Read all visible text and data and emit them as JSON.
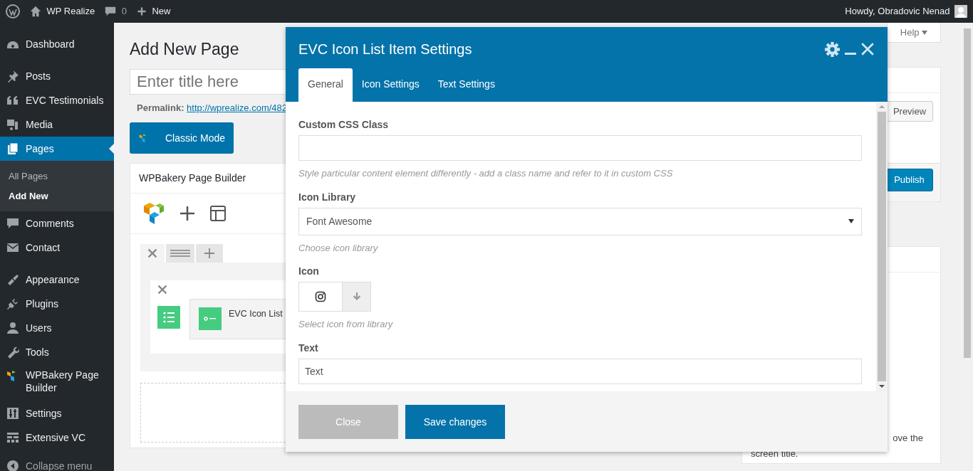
{
  "admin_bar": {
    "site": "WP Realize",
    "comments": "0",
    "new": "New",
    "greeting": "Howdy, Obradovic Nenad"
  },
  "menu_groups": [
    [
      {
        "label": "Dashboard",
        "selected": false
      }
    ],
    [
      {
        "label": "Posts",
        "selected": false
      },
      {
        "label": "EVC Testimonials",
        "selected": false
      },
      {
        "label": "Media",
        "selected": false
      },
      {
        "label": "Pages",
        "selected": true,
        "children": [
          {
            "label": "All Pages",
            "selected": false
          },
          {
            "label": "Add New",
            "selected": true
          }
        ]
      },
      {
        "label": "Comments",
        "selected": false
      },
      {
        "label": "Contact",
        "selected": false
      }
    ],
    [
      {
        "label": "Appearance",
        "selected": false
      },
      {
        "label": "Plugins",
        "selected": false
      },
      {
        "label": "Users",
        "selected": false
      },
      {
        "label": "Tools",
        "selected": false
      },
      {
        "label": "WPBakery Page Builder",
        "selected": false
      },
      {
        "label": "Settings",
        "selected": false
      },
      {
        "label": "Extensive VC",
        "selected": false
      }
    ]
  ],
  "collapse": "Collapse menu",
  "page": {
    "heading": "Add New Page",
    "title_placeholder": "Enter title here",
    "permalink_label": "Permalink:",
    "permalink_url": "http://wprealize.com/482",
    "classic_mode": "Classic Mode",
    "builder": {
      "title": "WPBakery Page Builder",
      "element": "EVC Icon List"
    }
  },
  "side": {
    "help": "Help",
    "preview": "Preview",
    "publish": "Publish",
    "note_line1": "ove the",
    "note_line2": "screen title."
  },
  "modal": {
    "title": "EVC Icon List Item Settings",
    "tabs": [
      {
        "label": "General",
        "selected": true
      },
      {
        "label": "Icon Settings",
        "selected": false
      },
      {
        "label": "Text Settings",
        "selected": false
      }
    ],
    "fields": [
      {
        "kind": "text",
        "label": "Custom CSS Class",
        "help": "Style particular content element differently - add a class name and refer to it in custom CSS"
      },
      {
        "kind": "select",
        "label": "Icon Library",
        "value": "Font Awesome",
        "help": "Choose icon library"
      },
      {
        "kind": "icon",
        "label": "Icon",
        "help": "Select icon from library"
      },
      {
        "kind": "text",
        "label": "Text",
        "value": "Text"
      }
    ],
    "buttons": {
      "close": "Close",
      "save": "Save changes"
    }
  }
}
